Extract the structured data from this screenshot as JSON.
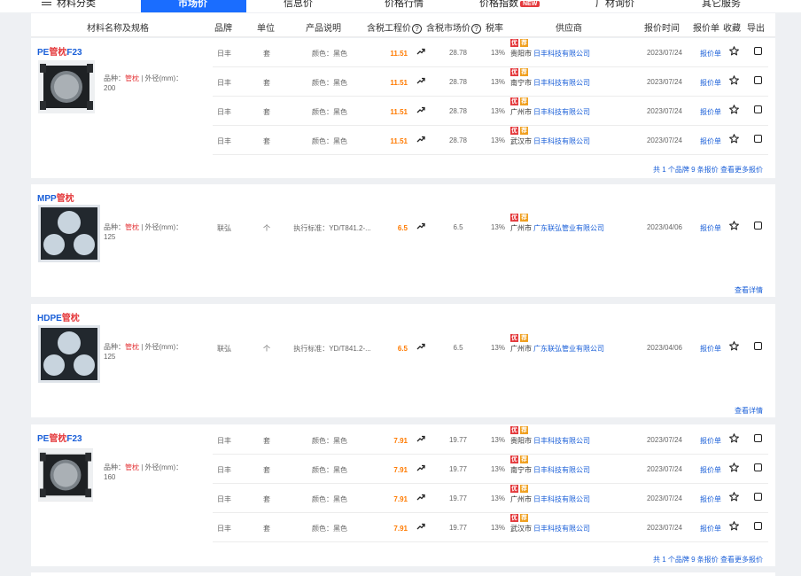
{
  "nav": {
    "items": [
      {
        "label": "材料分类",
        "x": 0
      },
      {
        "label": "信息价",
        "x": 0
      },
      {
        "label": "价格行情",
        "x": 0
      },
      {
        "label": "价格指数",
        "x": 0
      },
      {
        "label": "厂材询价",
        "x": 0
      },
      {
        "label": "其它服务",
        "x": 0
      }
    ],
    "active_label": "市场价",
    "new_badge": "NEW"
  },
  "table_header": {
    "name": "材料名称及规格",
    "brand": "品牌",
    "unit": "单位",
    "desc": "产品说明",
    "price_incl": "含税工程价",
    "market_price": "含税市场价",
    "help": "?",
    "tax": "税率",
    "supplier": "供应商",
    "time": "报价时间",
    "quote": "报价单",
    "collect": "收藏",
    "export": "导出"
  },
  "tags": {
    "you": "优",
    "jian": "荐"
  },
  "products": [
    {
      "title_a": "PE",
      "title_b": "管枕",
      "title_c": "F23",
      "spec_prefix": "品种：",
      "spec_kind": "管枕",
      "spec_rest": " | 外径(mm)：200",
      "image": "square-frame",
      "rows": [
        {
          "brand": "日丰",
          "unit": "套",
          "desc": "颜色：黑色",
          "price": "11.51",
          "market": "28.78",
          "tax": "13%",
          "city": "贵阳市",
          "company": "日丰科技有限公司",
          "date": "2023/07/24",
          "quote": "报价单"
        },
        {
          "brand": "日丰",
          "unit": "套",
          "desc": "颜色：黑色",
          "price": "11.51",
          "market": "28.78",
          "tax": "13%",
          "city": "南宁市",
          "company": "日丰科技有限公司",
          "date": "2023/07/24",
          "quote": "报价单"
        },
        {
          "brand": "日丰",
          "unit": "套",
          "desc": "颜色：黑色",
          "price": "11.51",
          "market": "28.78",
          "tax": "13%",
          "city": "广州市",
          "company": "日丰科技有限公司",
          "date": "2023/07/24",
          "quote": "报价单"
        },
        {
          "brand": "日丰",
          "unit": "套",
          "desc": "颜色：黑色",
          "price": "11.51",
          "market": "28.78",
          "tax": "13%",
          "city": "武汉市",
          "company": "日丰科技有限公司",
          "date": "2023/07/24",
          "quote": "报价单"
        }
      ],
      "more": "共 1 个品牌 9 条报价 查看更多报价"
    },
    {
      "title_a": "MPP",
      "title_b": "管枕",
      "title_c": "",
      "spec_prefix": "品种：",
      "spec_kind": "管枕",
      "spec_rest": " | 外径(mm)：125",
      "image": "triple-hole",
      "rows": [
        {
          "brand": "联弘",
          "unit": "个",
          "desc": "执行标准：YD/T841.2-...",
          "price": "6.5",
          "market": "6.5",
          "tax": "13%",
          "city": "广州市",
          "company": "广东联弘管业有限公司",
          "date": "2023/04/06",
          "quote": "报价单"
        }
      ],
      "more": "查看详情"
    },
    {
      "title_a": "HDPE",
      "title_b": "管枕",
      "title_c": "",
      "spec_prefix": "品种：",
      "spec_kind": "管枕",
      "spec_rest": " | 外径(mm)：125",
      "image": "triple-hole",
      "rows": [
        {
          "brand": "联弘",
          "unit": "个",
          "desc": "执行标准：YD/T841.2-...",
          "price": "6.5",
          "market": "6.5",
          "tax": "13%",
          "city": "广州市",
          "company": "广东联弘管业有限公司",
          "date": "2023/04/06",
          "quote": "报价单"
        }
      ],
      "more": "查看详情"
    },
    {
      "title_a": "PE",
      "title_b": "管枕",
      "title_c": "F23",
      "spec_prefix": "品种：",
      "spec_kind": "管枕",
      "spec_rest": " | 外径(mm)：160",
      "image": "square-frame",
      "rows": [
        {
          "brand": "日丰",
          "unit": "套",
          "desc": "颜色：黑色",
          "price": "7.91",
          "market": "19.77",
          "tax": "13%",
          "city": "贵阳市",
          "company": "日丰科技有限公司",
          "date": "2023/07/24",
          "quote": "报价单"
        },
        {
          "brand": "日丰",
          "unit": "套",
          "desc": "颜色：黑色",
          "price": "7.91",
          "market": "19.77",
          "tax": "13%",
          "city": "南宁市",
          "company": "日丰科技有限公司",
          "date": "2023/07/24",
          "quote": "报价单"
        },
        {
          "brand": "日丰",
          "unit": "套",
          "desc": "颜色：黑色",
          "price": "7.91",
          "market": "19.77",
          "tax": "13%",
          "city": "广州市",
          "company": "日丰科技有限公司",
          "date": "2023/07/24",
          "quote": "报价单"
        },
        {
          "brand": "日丰",
          "unit": "套",
          "desc": "颜色：黑色",
          "price": "7.91",
          "market": "19.77",
          "tax": "13%",
          "city": "武汉市",
          "company": "日丰科技有限公司",
          "date": "2023/07/24",
          "quote": "报价单"
        }
      ],
      "more": "共 1 个品牌 9 条报价 查看更多报价"
    }
  ],
  "colors": {
    "accent": "#1a6dff",
    "link": "#1a5fd8",
    "price": "#ff7a00",
    "tag_you": "#e4393c",
    "tag_jian": "#f0a020"
  },
  "icons": {
    "trend": "trend-up-icon",
    "collect": "star-icon",
    "menu": "hamburger-icon"
  }
}
